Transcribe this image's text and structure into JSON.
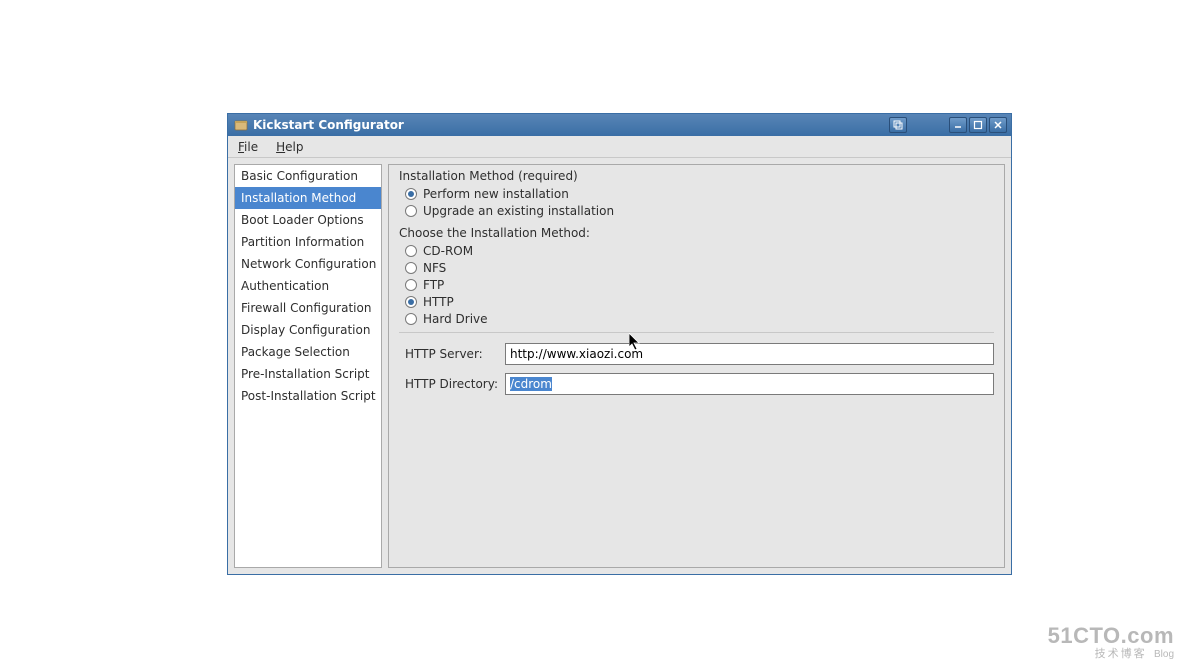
{
  "window": {
    "title": "Kickstart Configurator"
  },
  "menubar": {
    "file": "File",
    "help": "Help"
  },
  "sidebar": {
    "items": [
      {
        "label": "Basic Configuration"
      },
      {
        "label": "Installation Method"
      },
      {
        "label": "Boot Loader Options"
      },
      {
        "label": "Partition Information"
      },
      {
        "label": "Network Configuration"
      },
      {
        "label": "Authentication"
      },
      {
        "label": "Firewall Configuration"
      },
      {
        "label": "Display Configuration"
      },
      {
        "label": "Package Selection"
      },
      {
        "label": "Pre-Installation Script"
      },
      {
        "label": "Post-Installation Script"
      }
    ],
    "selected_index": 1
  },
  "main": {
    "section1_label": "Installation Method (required)",
    "install_types": {
      "new": "Perform new installation",
      "upgrade": "Upgrade an existing installation",
      "selected": "new"
    },
    "section2_label": "Choose the Installation Method:",
    "methods": {
      "cdrom": "CD-ROM",
      "nfs": "NFS",
      "ftp": "FTP",
      "http": "HTTP",
      "hd": "Hard Drive",
      "selected": "http"
    },
    "http": {
      "server_label": "HTTP Server:",
      "server_value": "http://www.xiaozi.com",
      "dir_label": "HTTP Directory:",
      "dir_value": "/cdrom"
    }
  },
  "watermark": {
    "line1": "51CTO.com",
    "line2_cn": "技术博客",
    "line2_en": "Blog"
  }
}
